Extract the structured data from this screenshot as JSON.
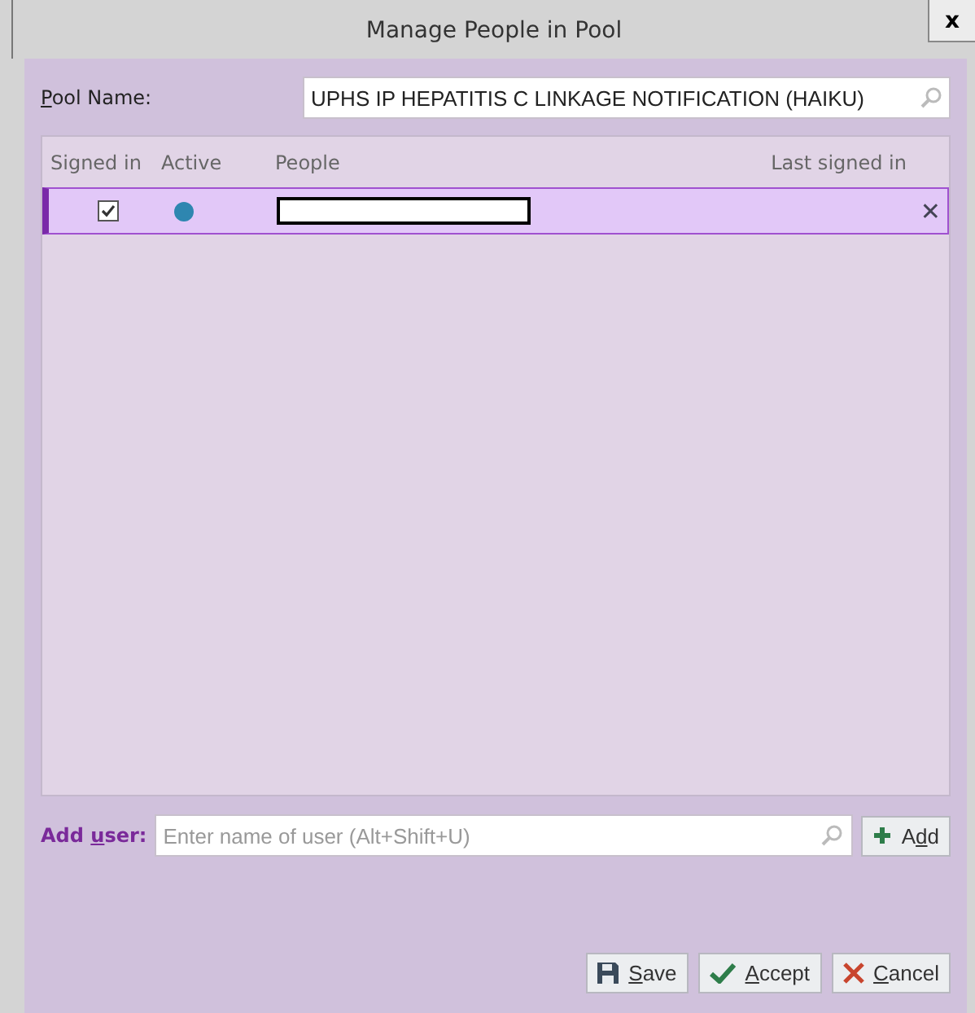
{
  "window": {
    "title": "Manage People in Pool",
    "close": "x"
  },
  "pool_name": {
    "label": {
      "key": "P",
      "after": "ool Name:"
    },
    "value": "UPHS IP HEPATITIS C LINKAGE NOTIFICATION (HAIKU)"
  },
  "table": {
    "columns": [
      "Signed in",
      "Active",
      "People",
      "Last signed in"
    ],
    "rows": [
      {
        "signed_in": true,
        "active": true,
        "color": "#2e86b0",
        "selected": true,
        "remove": "✕"
      }
    ]
  },
  "add_user": {
    "label": {
      "before": "Add ",
      "key": "u",
      "after": "ser:"
    },
    "placeholder": "Enter name of user (Alt+Shift+U)",
    "button": {
      "before": "A",
      "key": "d",
      "after": "d"
    }
  },
  "buttons": [
    {
      "kind": "save",
      "label": {
        "key": "S",
        "after": "ave"
      }
    },
    {
      "kind": "accept",
      "label": {
        "key": "A",
        "after": "ccept"
      }
    },
    {
      "kind": "cancel",
      "label": {
        "key": "C",
        "after": "ancel"
      }
    }
  ]
}
